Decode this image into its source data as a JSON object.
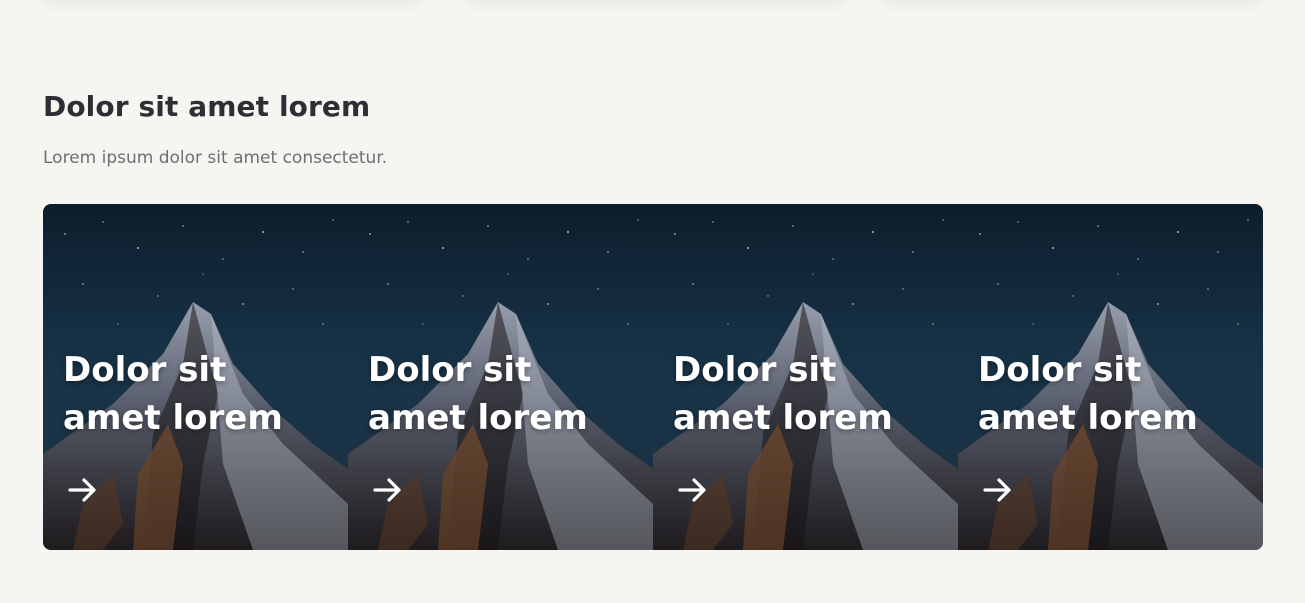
{
  "section": {
    "title": "Dolor sit amet lorem",
    "subtitle": "Lorem ipsum dolor sit amet consectetur."
  },
  "cards": [
    {
      "title": "Dolor sit amet lorem",
      "arrow_icon": "arrow-right-icon"
    },
    {
      "title": "Dolor sit amet lorem",
      "arrow_icon": "arrow-right-icon"
    },
    {
      "title": "Dolor sit amet lorem",
      "arrow_icon": "arrow-right-icon"
    },
    {
      "title": "Dolor sit amet lorem",
      "arrow_icon": "arrow-right-icon"
    }
  ],
  "colors": {
    "page_background": "#f7f5f1",
    "heading": "#2c2f33",
    "subtitle": "#6b6f74",
    "card_text": "#ffffff"
  }
}
